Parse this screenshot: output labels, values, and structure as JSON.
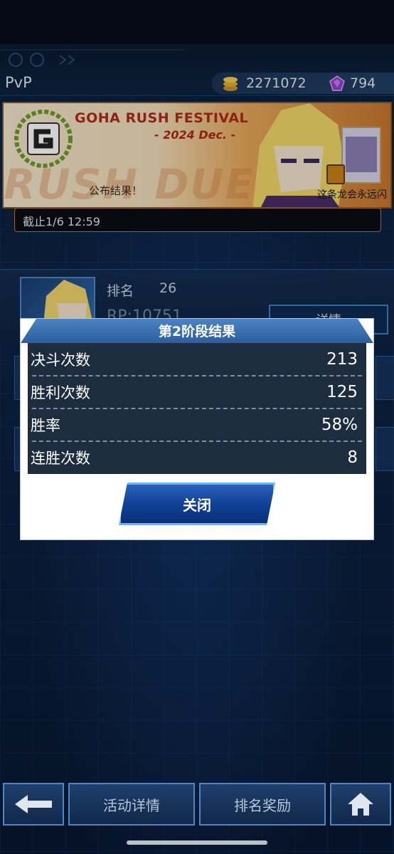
{
  "header": {
    "title": "PvP",
    "coins": "2271072",
    "gems": "794"
  },
  "banner": {
    "title": "GOHA RUSH FESTIVAL",
    "subtitle": "- 2024 Dec. -",
    "watermark": "RUSH DUEL",
    "announce": "公布结果！",
    "card_label": "这条龙会永远闪"
  },
  "deadline": "截止1/6 12:59",
  "rank": {
    "label": "排名",
    "value": "26",
    "rp": "RP:10751",
    "detail_button": "详情"
  },
  "modal": {
    "title": "第2阶段结果",
    "rows": [
      {
        "label": "决斗次数",
        "value": "213"
      },
      {
        "label": "胜利次数",
        "value": "125"
      },
      {
        "label": "胜率",
        "value": "58%"
      },
      {
        "label": "连胜次数",
        "value": "8"
      }
    ],
    "close_button": "关闭"
  },
  "nav": {
    "back_icon": "left-arrow-icon",
    "event_details": "活动详情",
    "ranking_rewards": "排名奖励",
    "home_icon": "home-icon"
  },
  "colors": {
    "modal_header": "#2d5e9d",
    "stats_bg": "#1d2c3f",
    "button_blue": "#0f3f95",
    "banner_title": "#b02a1a"
  }
}
